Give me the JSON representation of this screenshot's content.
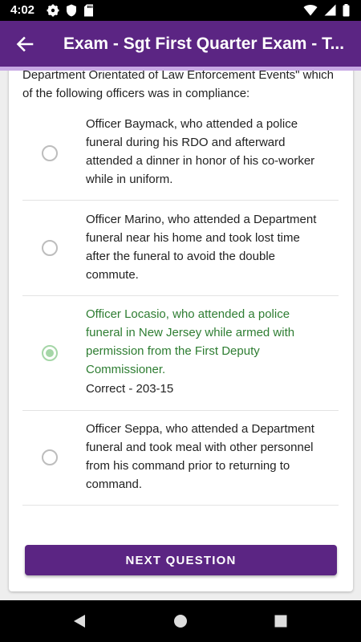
{
  "status_bar": {
    "time": "4:02",
    "left_icons": [
      "gear-icon",
      "shield-icon",
      "sd-card-icon"
    ],
    "right_icons": [
      "wifi-icon",
      "cellular-icon",
      "battery-icon"
    ]
  },
  "app_bar": {
    "title": "Exam - Sgt First Quarter Exam - T...",
    "back_icon": "arrow-back-icon",
    "color": "#5b2583"
  },
  "question": {
    "text": "Department Orientated of Law Enforcement Events\" which of the following officers was in compliance:"
  },
  "options": [
    {
      "text": "Officer Baymack, who attended a police funeral during his RDO and afterward attended a dinner in honor of his co-worker while in uniform.",
      "selected": false,
      "feedback": ""
    },
    {
      "text": "Officer Marino, who attended a Department funeral near his home and took lost time after the funeral to avoid the double commute.",
      "selected": false,
      "feedback": ""
    },
    {
      "text": "Officer Locasio, who attended a police funeral in New Jersey while armed with permission from the First Deputy Commissioner.",
      "selected": true,
      "feedback": "Correct - 203-15"
    },
    {
      "text": "Officer Seppa, who attended a Department funeral and took meal with other personnel from his command prior to returning to command.",
      "selected": false,
      "feedback": ""
    }
  ],
  "next_button": {
    "label": "NEXT QUESTION"
  },
  "nav_bar": {
    "icons": [
      "back-triangle-icon",
      "home-circle-icon",
      "recents-square-icon"
    ]
  },
  "colors": {
    "primary": "#5b2583",
    "correct": "#2e7d32",
    "radio_selected": "#a5d6a7"
  }
}
